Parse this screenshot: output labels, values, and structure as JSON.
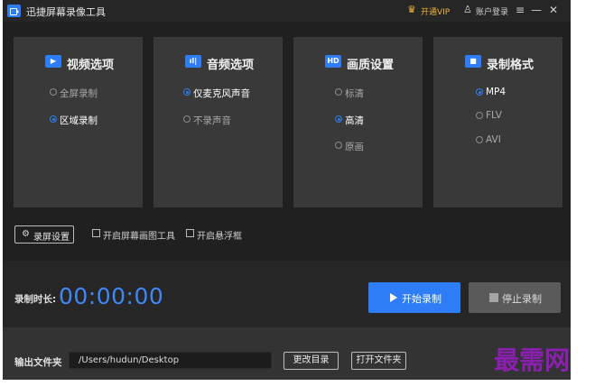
{
  "window": {
    "title": "迅捷屏幕录像工具",
    "vip_label": "开通VIP",
    "login_label": "账户登录",
    "controls": [
      "≡",
      "—",
      "✕"
    ]
  },
  "panels": [
    {
      "icon": "video-play-icon",
      "icon_glyph": "▶",
      "title": "视频选项",
      "options": [
        {
          "label": "全屏录制",
          "selected": false
        },
        {
          "label": "区域录制",
          "selected": true
        }
      ]
    },
    {
      "icon": "audio-wave-icon",
      "icon_glyph": "ıl|",
      "title": "音频选项",
      "options": [
        {
          "label": "仅麦克风声音",
          "selected": true
        },
        {
          "label": "不录声音",
          "selected": false
        }
      ]
    },
    {
      "icon": "hd-icon",
      "icon_glyph": "HD",
      "title": "画质设置",
      "options": [
        {
          "label": "标清",
          "selected": false
        },
        {
          "label": "高清",
          "selected": true
        },
        {
          "label": "原画",
          "selected": false
        }
      ]
    },
    {
      "icon": "camera-icon",
      "icon_glyph": "■",
      "title": "录制格式",
      "options": [
        {
          "label": "MP4",
          "selected": true
        },
        {
          "label": "FLV",
          "selected": false
        },
        {
          "label": "AVI",
          "selected": false
        }
      ]
    }
  ],
  "toolbar": {
    "settings_label": "录屏设置",
    "settings_icon_glyph": "⚙",
    "checkbox_draw": "开启屏幕画图工具",
    "checkbox_float": "开启悬浮框"
  },
  "recording": {
    "duration_label": "录制时长:",
    "timer": "00:00:00",
    "start_label": "开始录制",
    "stop_label": "停止录制"
  },
  "output": {
    "label": "输出文件夹",
    "path": "/Users/hudun/Desktop",
    "change_dir_label": "更改目录",
    "open_folder_label": "打开文件夹"
  },
  "watermark": "最需网",
  "colors": {
    "accent": "#2e7df6",
    "vip": "#f3b43b",
    "background": "#2b2b2b",
    "panel": "#393939",
    "watermark": "#8b1fb0"
  }
}
